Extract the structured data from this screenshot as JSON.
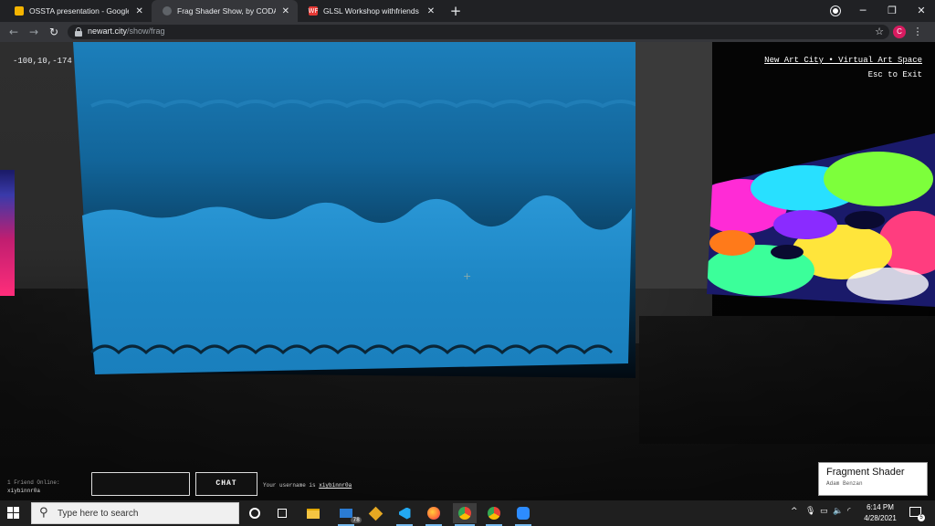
{
  "browser": {
    "tabs": [
      {
        "title": "OSSTA presentation - Google Sli",
        "close": "✕",
        "favicon_color": "#f4b400",
        "active": false
      },
      {
        "title": "Frag Shader Show, by CODAME",
        "close": "✕",
        "favicon_color": "#5f6368",
        "active": true
      },
      {
        "title": "GLSL Workshop withfriends",
        "close": "✕",
        "favicon_color": "#e53935",
        "favicon_text": "WF",
        "active": false
      }
    ],
    "new_tab": "+",
    "window_controls": {
      "minimize": "─",
      "maximize": "❐",
      "close": "✕"
    },
    "nav": {
      "back": "←",
      "forward": "→",
      "reload": "↻"
    },
    "url_host": "newart.city",
    "url_path": "/show/frag",
    "bookmark_icon": "☆",
    "profile_initial": "C",
    "menu_icon": "⋮"
  },
  "scene": {
    "coordinates": "-100,10,-174",
    "site_link": "New Art City • Virtual Art Space",
    "esc_hint": "Esc to Exit",
    "crosshair": "+",
    "friends_online": "1 Friend Online:",
    "friend_name": "xiybinnr0a",
    "chat_input_value": "",
    "chat_button": "CHAT",
    "username_prefix": "Your username is ",
    "username": "xiybinnr0a",
    "artwork_title": "Fragment Shader",
    "artwork_artist": "Adam Benzan",
    "panel_color": "#1f86c4",
    "panel_dark": "#04111c"
  },
  "taskbar": {
    "search_placeholder": "Type here to search",
    "mail_badge": "78",
    "tray_chevron": "^",
    "time": "6:14 PM",
    "date": "4/28/2021",
    "notification_count": "5",
    "pinned": [
      "cortana-icon",
      "task-view-icon",
      "file-explorer-icon",
      "mail-icon",
      "git-icon",
      "vscode-icon",
      "firefox-icon",
      "chrome-profile-icon",
      "chrome-icon",
      "zoom-icon"
    ]
  }
}
